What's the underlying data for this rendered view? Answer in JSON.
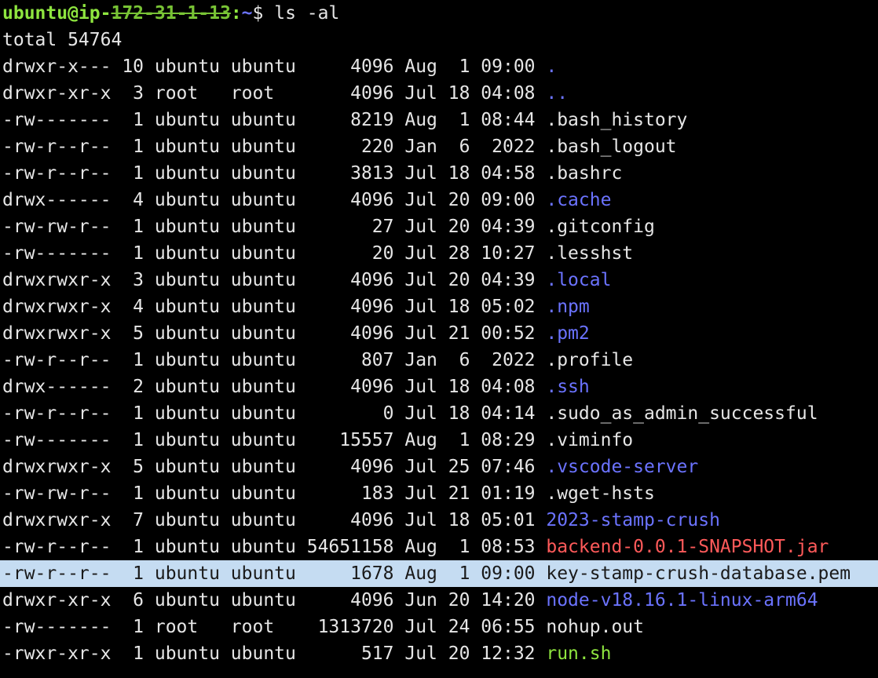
{
  "prompt": {
    "user": "ubuntu@ip-",
    "host_redacted": "172-31-1-13",
    "separator": ":",
    "path": "~",
    "dollar": "$ ",
    "command": "ls -al"
  },
  "total": "total 54764",
  "entries": [
    {
      "perms": "drwxr-x---",
      "links": "10",
      "owner": "ubuntu",
      "group": "ubuntu",
      "size": "4096",
      "month": "Aug",
      "day": "1",
      "time": "09:00",
      "name": ".",
      "type": "dir"
    },
    {
      "perms": "drwxr-xr-x",
      "links": "3",
      "owner": "root",
      "group": "root",
      "size": "4096",
      "month": "Jul",
      "day": "18",
      "time": "04:08",
      "name": "..",
      "type": "dir"
    },
    {
      "perms": "-rw-------",
      "links": "1",
      "owner": "ubuntu",
      "group": "ubuntu",
      "size": "8219",
      "month": "Aug",
      "day": "1",
      "time": "08:44",
      "name": ".bash_history",
      "type": "file"
    },
    {
      "perms": "-rw-r--r--",
      "links": "1",
      "owner": "ubuntu",
      "group": "ubuntu",
      "size": "220",
      "month": "Jan",
      "day": "6",
      "time": "2022",
      "name": ".bash_logout",
      "type": "file"
    },
    {
      "perms": "-rw-r--r--",
      "links": "1",
      "owner": "ubuntu",
      "group": "ubuntu",
      "size": "3813",
      "month": "Jul",
      "day": "18",
      "time": "04:58",
      "name": ".bashrc",
      "type": "file"
    },
    {
      "perms": "drwx------",
      "links": "4",
      "owner": "ubuntu",
      "group": "ubuntu",
      "size": "4096",
      "month": "Jul",
      "day": "20",
      "time": "09:00",
      "name": ".cache",
      "type": "dir"
    },
    {
      "perms": "-rw-rw-r--",
      "links": "1",
      "owner": "ubuntu",
      "group": "ubuntu",
      "size": "27",
      "month": "Jul",
      "day": "20",
      "time": "04:39",
      "name": ".gitconfig",
      "type": "file"
    },
    {
      "perms": "-rw-------",
      "links": "1",
      "owner": "ubuntu",
      "group": "ubuntu",
      "size": "20",
      "month": "Jul",
      "day": "28",
      "time": "10:27",
      "name": ".lesshst",
      "type": "file"
    },
    {
      "perms": "drwxrwxr-x",
      "links": "3",
      "owner": "ubuntu",
      "group": "ubuntu",
      "size": "4096",
      "month": "Jul",
      "day": "20",
      "time": "04:39",
      "name": ".local",
      "type": "dir"
    },
    {
      "perms": "drwxrwxr-x",
      "links": "4",
      "owner": "ubuntu",
      "group": "ubuntu",
      "size": "4096",
      "month": "Jul",
      "day": "18",
      "time": "05:02",
      "name": ".npm",
      "type": "dir"
    },
    {
      "perms": "drwxrwxr-x",
      "links": "5",
      "owner": "ubuntu",
      "group": "ubuntu",
      "size": "4096",
      "month": "Jul",
      "day": "21",
      "time": "00:52",
      "name": ".pm2",
      "type": "dir"
    },
    {
      "perms": "-rw-r--r--",
      "links": "1",
      "owner": "ubuntu",
      "group": "ubuntu",
      "size": "807",
      "month": "Jan",
      "day": "6",
      "time": "2022",
      "name": ".profile",
      "type": "file"
    },
    {
      "perms": "drwx------",
      "links": "2",
      "owner": "ubuntu",
      "group": "ubuntu",
      "size": "4096",
      "month": "Jul",
      "day": "18",
      "time": "04:08",
      "name": ".ssh",
      "type": "dir"
    },
    {
      "perms": "-rw-r--r--",
      "links": "1",
      "owner": "ubuntu",
      "group": "ubuntu",
      "size": "0",
      "month": "Jul",
      "day": "18",
      "time": "04:14",
      "name": ".sudo_as_admin_successful",
      "type": "file"
    },
    {
      "perms": "-rw-------",
      "links": "1",
      "owner": "ubuntu",
      "group": "ubuntu",
      "size": "15557",
      "month": "Aug",
      "day": "1",
      "time": "08:29",
      "name": ".viminfo",
      "type": "file"
    },
    {
      "perms": "drwxrwxr-x",
      "links": "5",
      "owner": "ubuntu",
      "group": "ubuntu",
      "size": "4096",
      "month": "Jul",
      "day": "25",
      "time": "07:46",
      "name": ".vscode-server",
      "type": "dir"
    },
    {
      "perms": "-rw-rw-r--",
      "links": "1",
      "owner": "ubuntu",
      "group": "ubuntu",
      "size": "183",
      "month": "Jul",
      "day": "21",
      "time": "01:19",
      "name": ".wget-hsts",
      "type": "file"
    },
    {
      "perms": "drwxrwxr-x",
      "links": "7",
      "owner": "ubuntu",
      "group": "ubuntu",
      "size": "4096",
      "month": "Jul",
      "day": "18",
      "time": "05:01",
      "name": "2023-stamp-crush",
      "type": "dir"
    },
    {
      "perms": "-rw-r--r--",
      "links": "1",
      "owner": "ubuntu",
      "group": "ubuntu",
      "size": "54651158",
      "month": "Aug",
      "day": "1",
      "time": "08:53",
      "name": "backend-0.0.1-SNAPSHOT.jar",
      "type": "archive"
    },
    {
      "perms": "-rw-r--r--",
      "links": "1",
      "owner": "ubuntu",
      "group": "ubuntu",
      "size": "1678",
      "month": "Aug",
      "day": "1",
      "time": "09:00",
      "name": "key-stamp-crush-database.pem",
      "type": "file",
      "selected": true
    },
    {
      "perms": "drwxr-xr-x",
      "links": "6",
      "owner": "ubuntu",
      "group": "ubuntu",
      "size": "4096",
      "month": "Jun",
      "day": "20",
      "time": "14:20",
      "name": "node-v18.16.1-linux-arm64",
      "type": "dir"
    },
    {
      "perms": "-rw-------",
      "links": "1",
      "owner": "root",
      "group": "root",
      "size": "1313720",
      "month": "Jul",
      "day": "24",
      "time": "06:55",
      "name": "nohup.out",
      "type": "file"
    },
    {
      "perms": "-rwxr-xr-x",
      "links": "1",
      "owner": "ubuntu",
      "group": "ubuntu",
      "size": "517",
      "month": "Jul",
      "day": "20",
      "time": "12:32",
      "name": "run.sh",
      "type": "exec"
    }
  ],
  "colors": {
    "background": "#000000",
    "text": "#e6e6e6",
    "directory": "#6b73ff",
    "archive": "#ff5a5a",
    "executable": "#8ee53f",
    "prompt_user": "#8ee53f",
    "selection": "#c5dcf2"
  }
}
